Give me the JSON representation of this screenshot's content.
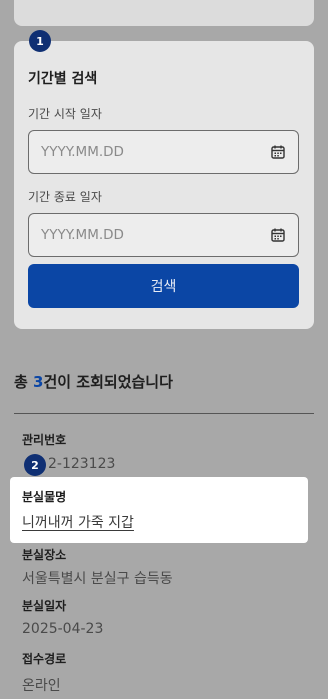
{
  "search_card": {
    "step": "1",
    "title": "기간별 검색",
    "start_label": "기간 시작 일자",
    "start_placeholder": "YYYY.MM.DD",
    "end_label": "기간 종료 일자",
    "end_placeholder": "YYYY.MM.DD",
    "search_button": "검색"
  },
  "results": {
    "prefix": "총 ",
    "count": "3",
    "suffix": "건이 조회되었습니다"
  },
  "detail": {
    "step": "2",
    "mgmt_label": "관리번호",
    "mgmt_value": "2-123123",
    "item_label": "분실물명",
    "item_value": "니꺼내꺼 가죽 지갑",
    "place_label": "분실장소",
    "place_value": "서울특별시 분실구 습득동",
    "date_label": "분실일자",
    "date_value": "2025-04-23",
    "route_label": "접수경로",
    "route_value": "온라인"
  },
  "colors": {
    "overlay": "#a8a8a8",
    "badge": "#0f2f73",
    "primary": "#0b46a5"
  },
  "icons": [
    "calendar-icon"
  ]
}
